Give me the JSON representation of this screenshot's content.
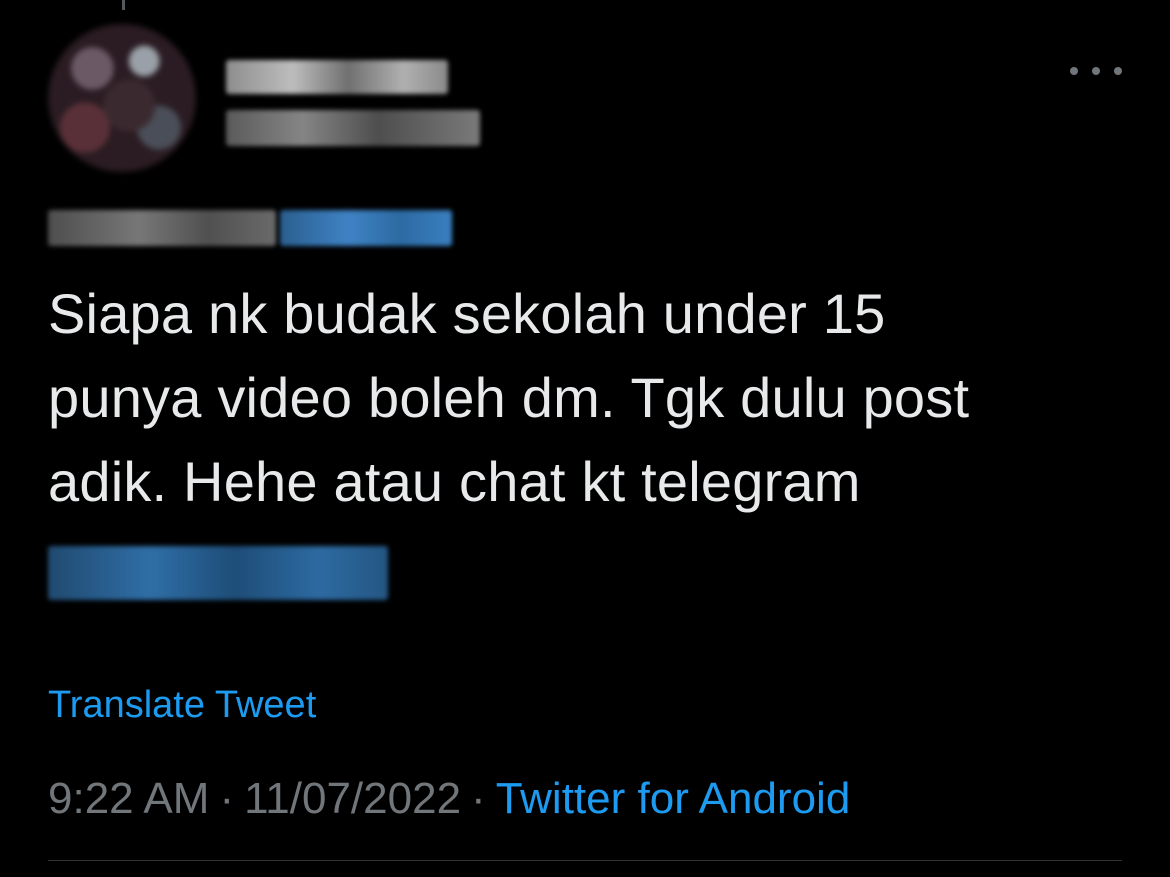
{
  "tweet": {
    "body_lines": [
      "Siapa nk budak sekolah under 15",
      "punya video boleh dm. Tgk dulu post",
      "adik. Hehe atau chat kt telegram"
    ],
    "translate_label": "Translate Tweet",
    "time": "9:22 AM",
    "separator": "·",
    "date": "11/07/2022",
    "source": "Twitter for Android"
  },
  "icons": {
    "more": "more-horizontal-icon"
  },
  "colors": {
    "background": "#000000",
    "text": "#e7e9ea",
    "secondary": "#71767b",
    "link": "#1d9bf0",
    "divider": "#2f3336"
  }
}
